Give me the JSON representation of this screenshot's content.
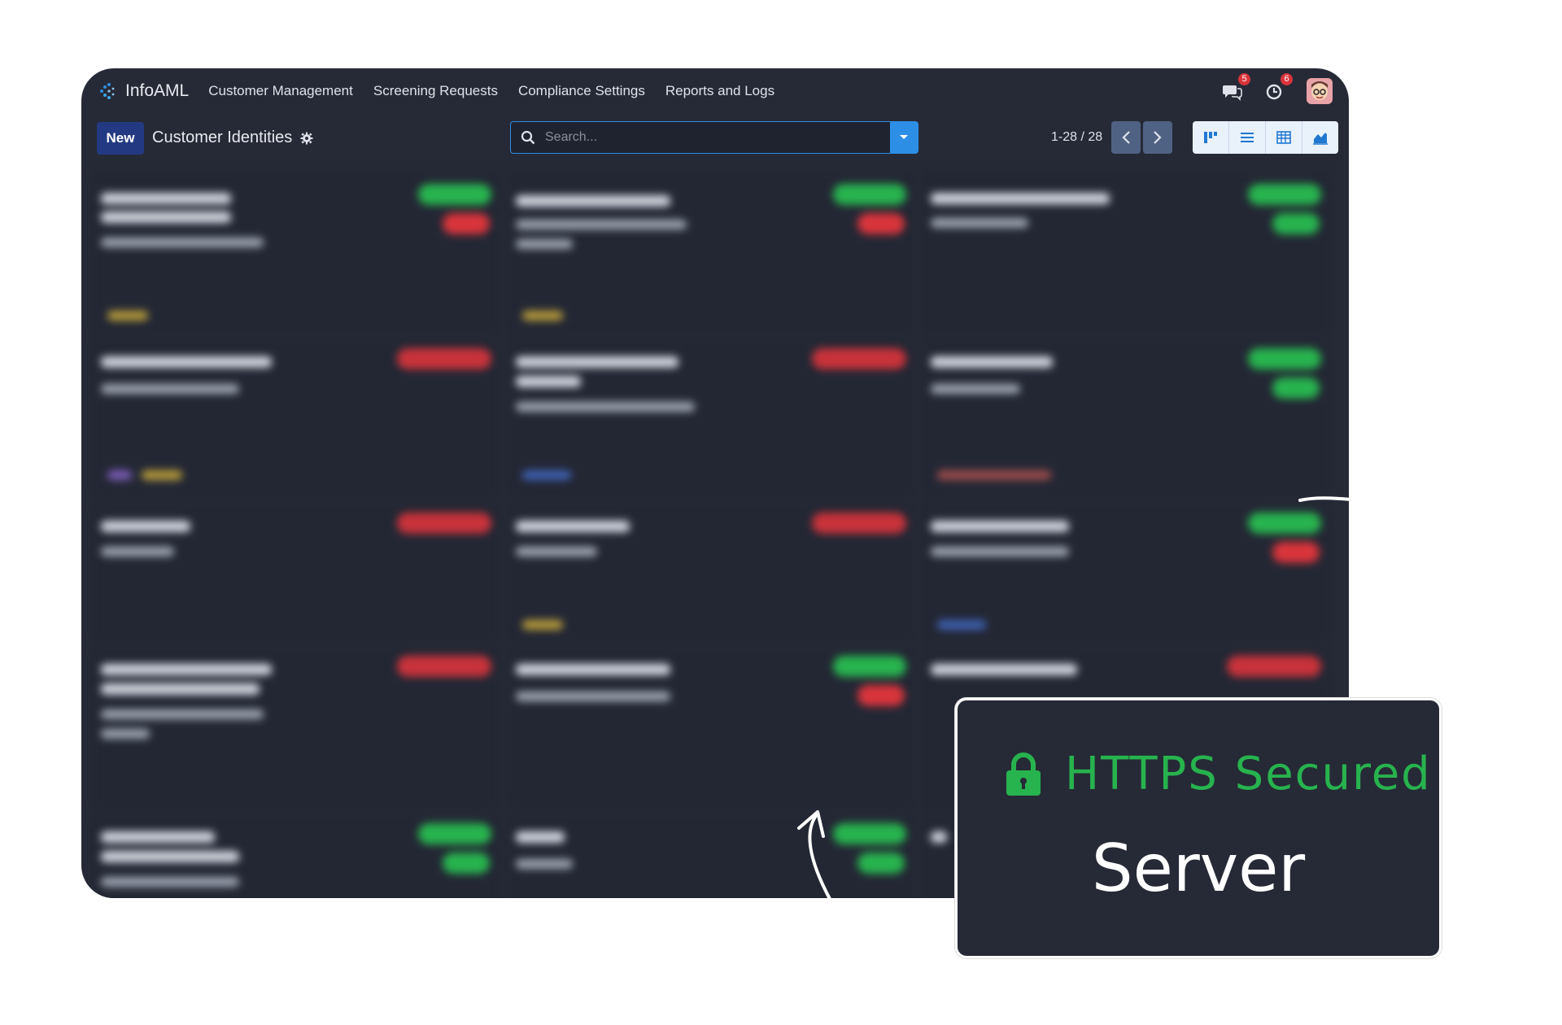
{
  "navbar": {
    "app_name": "InfoAML",
    "menu": [
      {
        "label": "Customer Management"
      },
      {
        "label": "Screening Requests"
      },
      {
        "label": "Compliance Settings"
      },
      {
        "label": "Reports and Logs"
      }
    ],
    "messages_badge": "5",
    "activities_badge": "6"
  },
  "controlbar": {
    "new_label": "New",
    "title": "Customer Identities",
    "search_placeholder": "Search...",
    "pager": "1-28 / 28"
  },
  "views": [
    "kanban-icon",
    "list-icon",
    "pivot-icon",
    "graph-icon"
  ],
  "overlay": {
    "line1": "HTTPS Secured",
    "line2": "Server"
  },
  "colors": {
    "background": "#262a36",
    "accent": "#2d8ee6",
    "success": "#27b34e",
    "danger": "#d9343b"
  }
}
